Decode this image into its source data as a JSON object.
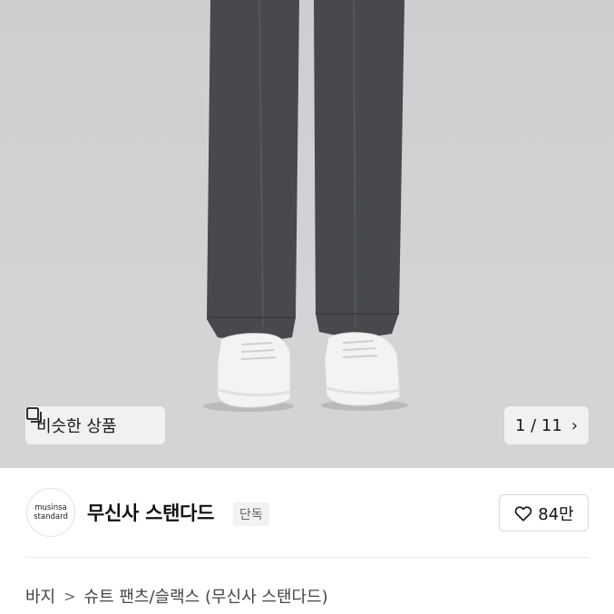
{
  "hero": {
    "similar_label": "비슷한 상품",
    "counter": "1 / 11",
    "counter_icon": "chevron-right-icon",
    "similar_icon": "similar-items-icon"
  },
  "brand": {
    "logo_line1": "musinsa",
    "logo_line2": "standard",
    "name": "무신사 스탠다드",
    "badge": "단독"
  },
  "like": {
    "icon": "heart-icon",
    "count": "84만"
  },
  "breadcrumb": {
    "items": [
      "바지",
      "슈트 팬츠/슬랙스 (무신사 스탠다드)"
    ],
    "separator": ">"
  },
  "colors": {
    "pants": "#47494c",
    "sneakers": "#f3f3f3",
    "background": "#cfd0d2"
  }
}
